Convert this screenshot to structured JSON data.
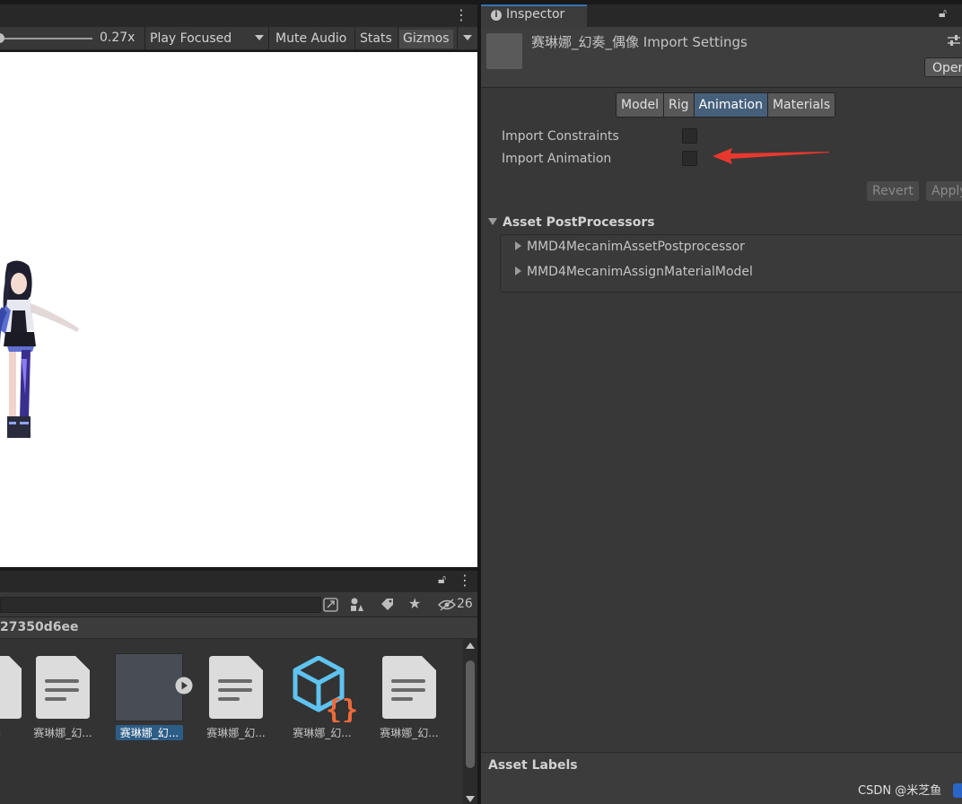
{
  "game_view": {
    "zoom_value": "0.27x",
    "play_mode": "Play Focused",
    "mute_audio_label": "Mute Audio",
    "stats_label": "Stats",
    "gizmos_label": "Gizmos"
  },
  "project_panel": {
    "hidden_count": "26",
    "path_suffix": "27350d6ee",
    "assets": [
      {
        "label": "...",
        "icon": "document-icon"
      },
      {
        "label": "赛琳娜_幻...",
        "icon": "document-icon"
      },
      {
        "label": "赛琳娜_幻...",
        "icon": "model-prefab-icon",
        "selected": true
      },
      {
        "label": "赛琳娜_幻...",
        "icon": "document-icon"
      },
      {
        "label": "赛琳娜_幻...",
        "icon": "json-cube-icon"
      },
      {
        "label": "赛琳娜_幻...",
        "icon": "document-icon"
      }
    ]
  },
  "inspector": {
    "tab_label": "Inspector",
    "title": "赛琳娜_幻奏_偶像 Import Settings",
    "open_button": "Open",
    "tabs": [
      "Model",
      "Rig",
      "Animation",
      "Materials"
    ],
    "active_tab": "Animation",
    "fields": {
      "import_constraints": {
        "label": "Import Constraints",
        "checked": false
      },
      "import_animation": {
        "label": "Import Animation",
        "checked": false
      }
    },
    "revert_button": "Revert",
    "apply_button": "Apply",
    "postprocessors": {
      "title": "Asset PostProcessors",
      "items": [
        "MMD4MecanimAssetPostprocessor",
        "MMD4MecanimAssignMaterialModel"
      ]
    },
    "asset_labels_title": "Asset Labels"
  },
  "watermark": "CSDN @米芝鱼",
  "colors": {
    "accent_active_tab": "#46607c",
    "selection": "#2c5d87",
    "annotation_arrow": "#e8382e"
  }
}
